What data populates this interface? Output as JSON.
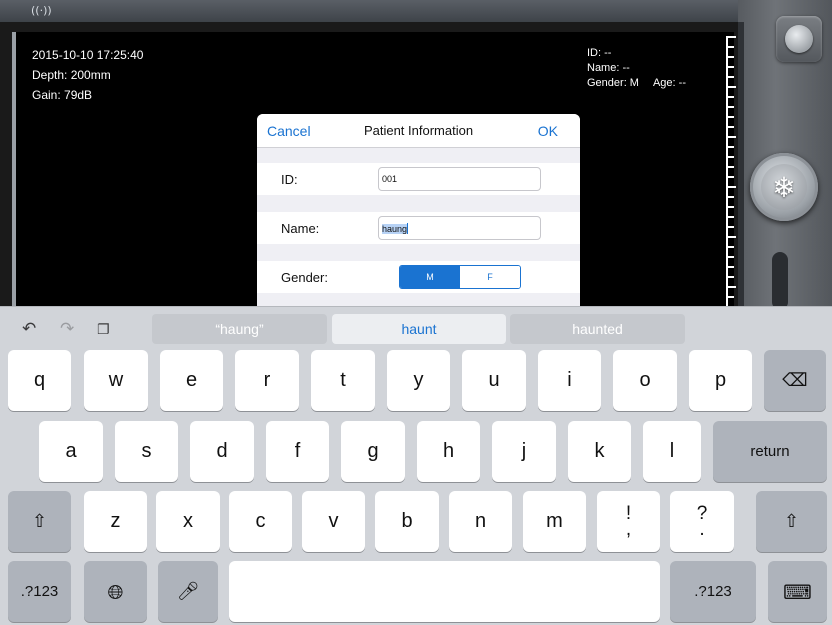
{
  "status": {
    "signal_icon": "signal-icon"
  },
  "screen": {
    "left": [
      "2015-10-10 17:25:40",
      "Depth: 200mm",
      "Gain: 79dB"
    ],
    "right_id": "ID: --",
    "right_name": "Name: --",
    "right_gender": "Gender: M",
    "right_age": "Age: --"
  },
  "dialog": {
    "cancel": "Cancel",
    "title": "Patient Information",
    "ok": "OK",
    "id_label": "ID:",
    "id_value": "001",
    "name_label": "Name:",
    "name_value": "haung",
    "gender_label": "Gender:",
    "gender_options": [
      "M",
      "F"
    ],
    "gender_selected": "M"
  },
  "keyboard": {
    "suggestions": [
      "“haung”",
      "haunt",
      "haunted"
    ],
    "row1": [
      "q",
      "w",
      "e",
      "r",
      "t",
      "y",
      "u",
      "i",
      "o",
      "p"
    ],
    "row2": [
      "a",
      "s",
      "d",
      "f",
      "g",
      "h",
      "j",
      "k",
      "l"
    ],
    "row3": [
      "z",
      "x",
      "c",
      "v",
      "b",
      "n",
      "m"
    ],
    "punct1": [
      "!",
      ","
    ],
    "punct2": [
      "?",
      "."
    ],
    "return": "return",
    "num1": ".?123",
    "num2": ".?123"
  },
  "colors": {
    "accent": "#1a73d1",
    "key": "#ffffff",
    "key_dark": "#aeb3bb",
    "keyboard_bg": "#d1d4d9"
  }
}
